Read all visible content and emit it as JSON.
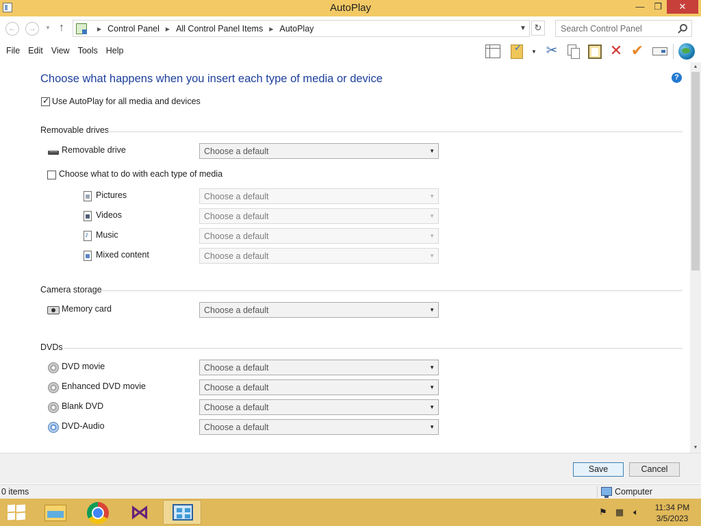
{
  "window": {
    "title": "AutoPlay"
  },
  "address": {
    "crumbs": [
      "Control Panel",
      "All Control Panel Items",
      "AutoPlay"
    ],
    "search_placeholder": "Search Control Panel"
  },
  "menu": {
    "items": [
      "File",
      "Edit",
      "View",
      "Tools",
      "Help"
    ]
  },
  "toolbar": {
    "icons": [
      "layout-icon",
      "properties-icon",
      "cut-icon",
      "copy-icon",
      "paste-icon",
      "delete-icon",
      "checkmark-icon",
      "rename-icon",
      "globe-icon"
    ]
  },
  "content": {
    "heading": "Choose what happens when you insert each type of media or device",
    "use_autoplay": {
      "label": "Use AutoPlay for all media and devices",
      "checked": true
    },
    "removable": {
      "title": "Removable drives",
      "drive": {
        "label": "Removable drive",
        "value": "Choose a default"
      },
      "each_media": {
        "label": "Choose what to do with each type of media",
        "checked": false
      },
      "media": [
        {
          "label": "Pictures",
          "value": "Choose a default"
        },
        {
          "label": "Videos",
          "value": "Choose a default"
        },
        {
          "label": "Music",
          "value": "Choose a default"
        },
        {
          "label": "Mixed content",
          "value": "Choose a default"
        }
      ]
    },
    "camera": {
      "title": "Camera storage",
      "memory_card": {
        "label": "Memory card",
        "value": "Choose a default"
      }
    },
    "dvds": {
      "title": "DVDs",
      "items": [
        {
          "label": "DVD movie",
          "value": "Choose a default"
        },
        {
          "label": "Enhanced DVD movie",
          "value": "Choose a default"
        },
        {
          "label": "Blank DVD",
          "value": "Choose a default"
        },
        {
          "label": "DVD-Audio",
          "value": "Choose a default"
        }
      ]
    }
  },
  "buttons": {
    "save": "Save",
    "cancel": "Cancel"
  },
  "statusbar": {
    "items": "0 items",
    "location": "Computer"
  },
  "taskbar": {
    "time": "11:34 PM",
    "date": "3/5/2023"
  },
  "colors": {
    "accent_title": "#f2c965",
    "heading_blue": "#1d3f9e",
    "taskbar": "#e0b95a",
    "close_red": "#c7403a"
  }
}
